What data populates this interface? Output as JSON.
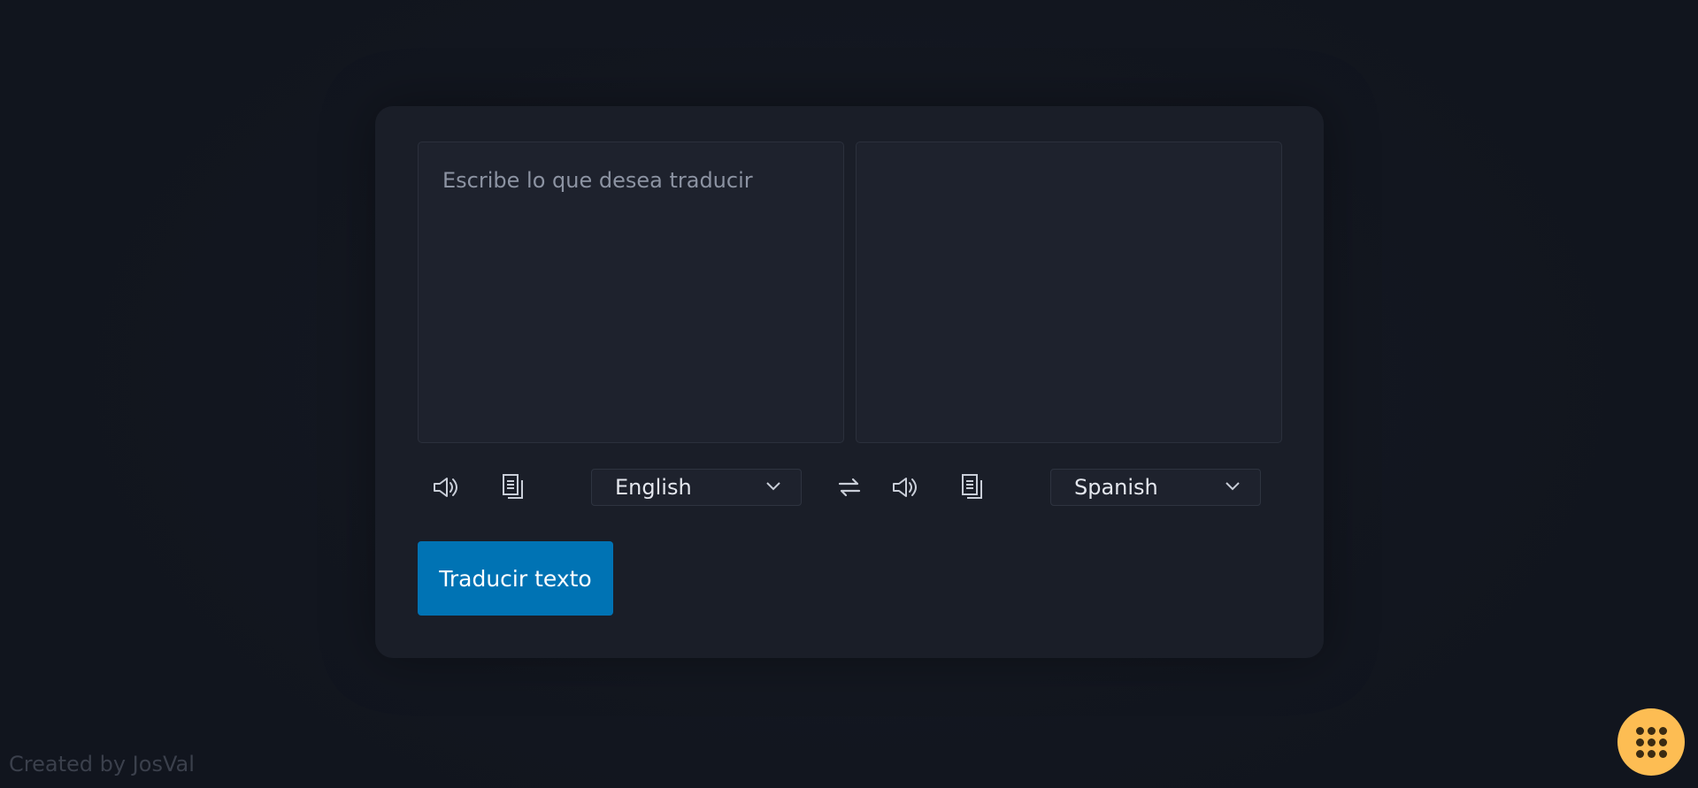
{
  "source": {
    "placeholder": "Escribe lo que desea traducir",
    "value": "",
    "language": "English"
  },
  "target": {
    "value": "",
    "language": "Spanish"
  },
  "icons": {
    "speak": "speaker-icon",
    "copy": "copy-icon",
    "swap": "swap-arrows-icon",
    "dropdown": "chevron-down-icon",
    "menu": "grid-dots-icon"
  },
  "actions": {
    "translate_label": "Traducir texto"
  },
  "footer": {
    "credit": "Created by JosVal"
  },
  "colors": {
    "background": "#121620",
    "card": "#1a1e28",
    "panel": "#1e222d",
    "accent": "#0073b4",
    "fab": "#fdbd53"
  }
}
